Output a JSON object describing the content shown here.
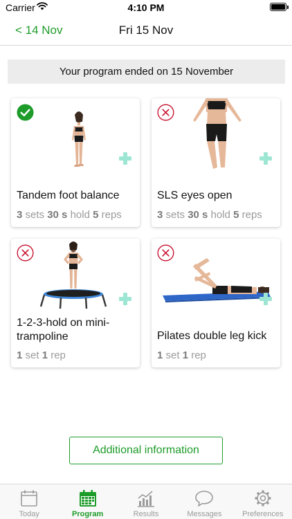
{
  "status_bar": {
    "carrier": "Carrier",
    "time": "4:10 PM"
  },
  "nav": {
    "back_label": "< 14 Nov",
    "title": "Fri 15 Nov"
  },
  "banner": "Your program ended on 15 November",
  "colors": {
    "accent": "#1e9c2a",
    "incomplete": "#c8102e",
    "plus": "#9ee6d4"
  },
  "exercises": [
    {
      "title": "Tandem foot balance",
      "status": "completed",
      "status_icon": "check-circle-icon",
      "sets": "3",
      "sets_label": "sets",
      "hold": "30 s",
      "hold_label": "hold",
      "reps": "5",
      "reps_label": "reps"
    },
    {
      "title": "SLS eyes open",
      "status": "not-completed",
      "status_icon": "x-circle-icon",
      "sets": "3",
      "sets_label": "sets",
      "hold": "30 s",
      "hold_label": "hold",
      "reps": "5",
      "reps_label": "reps"
    },
    {
      "title": "1-2-3-hold on mini-trampoline",
      "status": "not-completed",
      "status_icon": "x-circle-icon",
      "sets": "1",
      "sets_label": "set",
      "reps": "1",
      "reps_label": "rep"
    },
    {
      "title": "Pilates double leg kick",
      "status": "not-completed",
      "status_icon": "x-circle-icon",
      "sets": "1",
      "sets_label": "set",
      "reps": "1",
      "reps_label": "rep"
    }
  ],
  "additional_info_label": "Additional information",
  "tabs": [
    {
      "label": "Today",
      "icon": "calendar-icon",
      "active": false
    },
    {
      "label": "Program",
      "icon": "calendar-grid-icon",
      "active": true
    },
    {
      "label": "Results",
      "icon": "chart-icon",
      "active": false
    },
    {
      "label": "Messages",
      "icon": "speech-bubble-icon",
      "active": false
    },
    {
      "label": "Preferences",
      "icon": "gear-icon",
      "active": false
    }
  ]
}
